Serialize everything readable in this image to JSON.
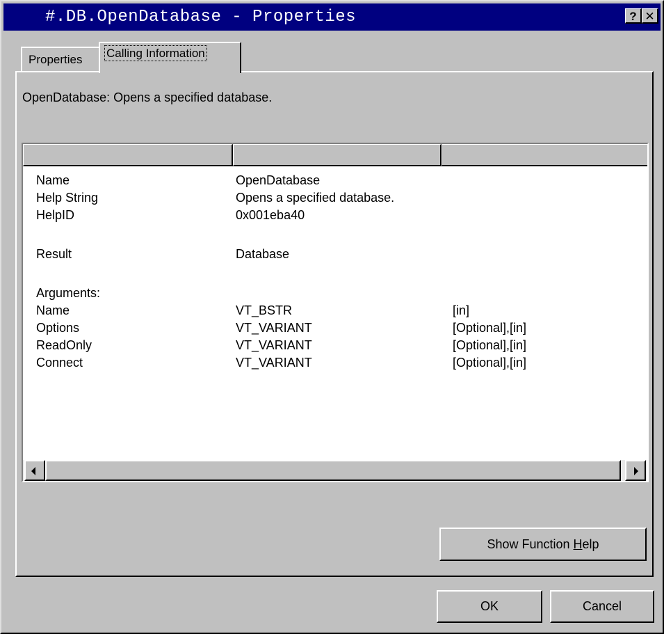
{
  "window": {
    "title": "#.DB.OpenDatabase - Properties",
    "help_button": "?",
    "close_button": "✕"
  },
  "tabs": [
    {
      "label": "Properties",
      "active": false
    },
    {
      "label": "Calling Information",
      "active": true
    }
  ],
  "summary": "OpenDatabase: Opens a specified database.",
  "list": {
    "rows": [
      {
        "c1": "Name",
        "c2": "OpenDatabase",
        "c3": ""
      },
      {
        "c1": "Help String",
        "c2": "Opens a specified database.",
        "c3": ""
      },
      {
        "c1": "HelpID",
        "c2": "0x001eba40",
        "c3": ""
      },
      {
        "c1": "",
        "c2": "",
        "c3": ""
      },
      {
        "c1": "Result",
        "c2": "Database",
        "c3": ""
      },
      {
        "c1": "",
        "c2": "",
        "c3": ""
      },
      {
        "c1": "Arguments:",
        "c2": "",
        "c3": ""
      },
      {
        "c1": "Name",
        "c2": "VT_BSTR",
        "c3": "[in]"
      },
      {
        "c1": "Options",
        "c2": "VT_VARIANT",
        "c3": "[Optional],[in]"
      },
      {
        "c1": "ReadOnly",
        "c2": "VT_VARIANT",
        "c3": "[Optional],[in]"
      },
      {
        "c1": "Connect",
        "c2": "VT_VARIANT",
        "c3": "[Optional],[in]"
      }
    ]
  },
  "buttons": {
    "show_help_prefix": "Show Function ",
    "show_help_accel": "H",
    "show_help_suffix": "elp",
    "ok": "OK",
    "cancel": "Cancel"
  }
}
